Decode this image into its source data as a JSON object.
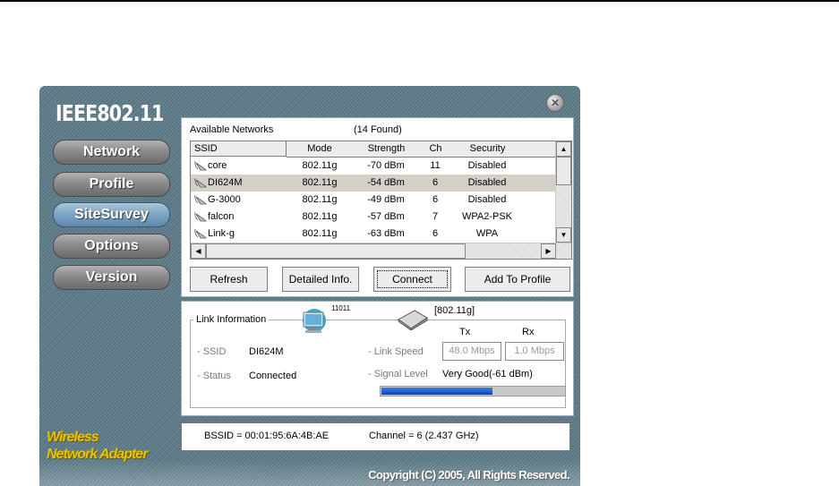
{
  "app": {
    "logo": "IEEE802.11",
    "brand_line1": "Wireless",
    "brand_line2": "Network Adapter",
    "copyright": "Copyright (C) 2005, All Rights Reserved."
  },
  "nav": {
    "items": [
      {
        "label": "Network",
        "active": false
      },
      {
        "label": "Profile",
        "active": false
      },
      {
        "label": "SiteSurvey",
        "active": true
      },
      {
        "label": "Options",
        "active": false
      },
      {
        "label": "Version",
        "active": false
      }
    ]
  },
  "survey": {
    "label": "Available Networks",
    "count": "(14 Found)",
    "columns": [
      "SSID",
      "Mode",
      "Strength",
      "Ch",
      "Security"
    ],
    "rows": [
      {
        "ssid": "core",
        "mode": "802.11g",
        "strength": "-70 dBm",
        "ch": "11",
        "security": "Disabled",
        "selected": false
      },
      {
        "ssid": "DI624M",
        "mode": "802.11g",
        "strength": "-54 dBm",
        "ch": "6",
        "security": "Disabled",
        "selected": true
      },
      {
        "ssid": "G-3000",
        "mode": "802.11g",
        "strength": "-49 dBm",
        "ch": "6",
        "security": "Disabled",
        "selected": false
      },
      {
        "ssid": "falcon",
        "mode": "802.11g",
        "strength": "-57 dBm",
        "ch": "7",
        "security": "WPA2-PSK",
        "selected": false
      },
      {
        "ssid": "Link-g",
        "mode": "802.11g",
        "strength": "-63 dBm",
        "ch": "6",
        "security": "WPA",
        "selected": false
      }
    ],
    "buttons": {
      "refresh": "Refresh",
      "detailed": "Detailed Info.",
      "connect": "Connect",
      "add": "Add To Profile"
    }
  },
  "link": {
    "title": "Link Information",
    "icon_badge": "11011",
    "mode": "[802.11g]",
    "tx_label": "Tx",
    "rx_label": "Rx",
    "ssid_label": "- SSID",
    "ssid_value": "DI624M",
    "status_label": "- Status",
    "status_value": "Connected",
    "speed_label": "- Link Speed",
    "tx_value": "48.0 Mbps",
    "rx_value": "1.0 Mbps",
    "signal_label": "- Signal Level",
    "signal_value": "Very Good(-61 dBm)",
    "signal_fraction": 0.6
  },
  "footer": {
    "bssid": "BSSID = 00:01:95:6A:4B:AE",
    "channel": "Channel = 6 (2.437 GHz)"
  },
  "colors": {
    "accent": "#1f5fc9",
    "brand": "#e8c300",
    "chrome": "#6d8a96"
  }
}
